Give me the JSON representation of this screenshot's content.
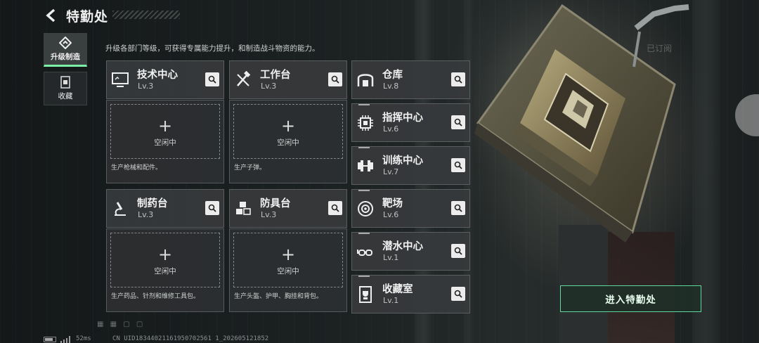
{
  "header": {
    "title": "特勤处",
    "description": "升级各部门等级，可获得专属能力提升，和制造战斗物资的能力。",
    "subscribe_label": "已订阅"
  },
  "side_tabs": [
    {
      "label": "升级制造",
      "icon": "upgrade-icon",
      "active": true
    },
    {
      "label": "收藏",
      "icon": "collection-icon",
      "active": false
    }
  ],
  "facilities": [
    {
      "name": "技术中心",
      "level": "Lv.3",
      "icon": "monitor-icon",
      "slot": "空闲中",
      "product": "生产枪械和配件。"
    },
    {
      "name": "工作台",
      "level": "Lv.3",
      "icon": "tools-icon",
      "slot": "空闲中",
      "product": "生产子弹。"
    },
    {
      "name": "制药台",
      "level": "Lv.3",
      "icon": "microscope-icon",
      "slot": "空闲中",
      "product": "生产药品、针剂和维修工具包。"
    },
    {
      "name": "防具台",
      "level": "Lv.3",
      "icon": "cubes-icon",
      "slot": "空闲中",
      "product": "生产头盔、护甲、胸挂和背包。"
    }
  ],
  "departments": [
    {
      "name": "仓库",
      "level": "Lv.8",
      "icon": "warehouse-icon"
    },
    {
      "name": "指挥中心",
      "level": "Lv.6",
      "icon": "chip-icon"
    },
    {
      "name": "训练中心",
      "level": "Lv.7",
      "icon": "dumbbell-icon"
    },
    {
      "name": "靶场",
      "level": "Lv.6",
      "icon": "target-icon"
    },
    {
      "name": "潜水中心",
      "level": "Lv.1",
      "icon": "goggles-icon"
    },
    {
      "name": "收藏室",
      "level": "Lv.1",
      "icon": "trophy-icon"
    }
  ],
  "enter_button": "进入特勤处",
  "footer": {
    "ping": "52ms",
    "uid": "CN UID18344021161950702561 1_202605121852"
  },
  "colors": {
    "accent": "#7df0a8",
    "card": "#373a3c"
  }
}
